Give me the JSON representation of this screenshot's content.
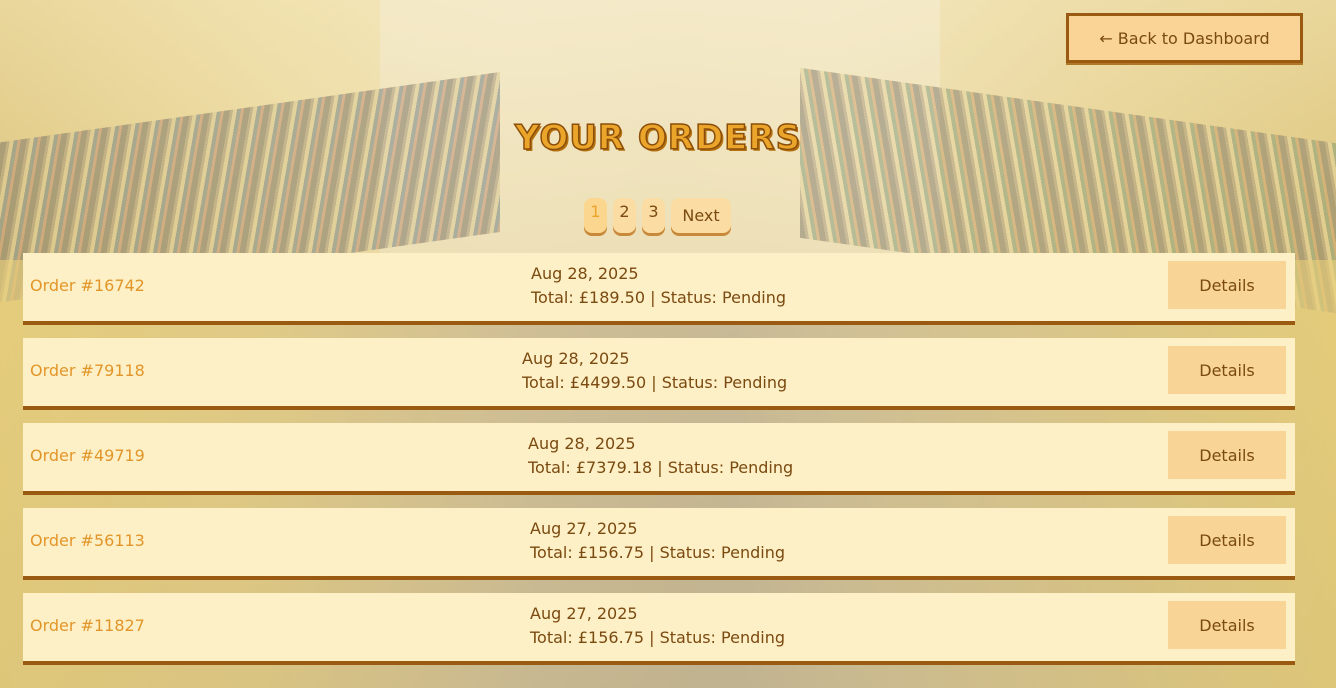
{
  "header": {
    "back_label": "← Back to Dashboard",
    "title": "YOUR ORDERS"
  },
  "pagination": {
    "pages": [
      "1",
      "2",
      "3"
    ],
    "current": "1",
    "next_label": "Next"
  },
  "orders": [
    {
      "id": "Order #16742",
      "date": "Aug 28, 2025",
      "summary": "Total: £189.50 | Status: Pending",
      "action": "Details"
    },
    {
      "id": "Order #79118",
      "date": "Aug 28, 2025",
      "summary": "Total: £4499.50 | Status: Pending",
      "action": "Details"
    },
    {
      "id": "Order #49719",
      "date": "Aug 28, 2025",
      "summary": "Total: £7379.18 | Status: Pending",
      "action": "Details"
    },
    {
      "id": "Order #56113",
      "date": "Aug 27, 2025",
      "summary": "Total: £156.75 | Status: Pending",
      "action": "Details"
    },
    {
      "id": "Order #11827",
      "date": "Aug 27, 2025",
      "summary": "Total: £156.75 | Status: Pending",
      "action": "Details"
    }
  ],
  "colors": {
    "accent": "#eba52b",
    "dark_brown": "#7a4a10",
    "row_bg": "#fdefc6",
    "button_bg": "#f8d496",
    "row_border": "#9a5a12"
  }
}
